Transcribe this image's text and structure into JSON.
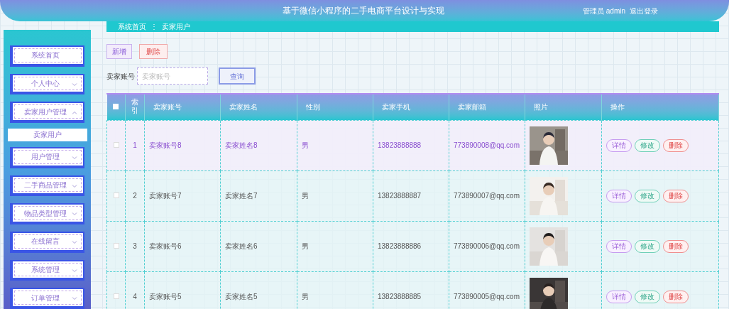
{
  "header": {
    "title": "基于微信小程序的二手电商平台设计与实现",
    "user": "管理员 admin",
    "logout": "退出登录"
  },
  "sidebar": {
    "items": [
      {
        "label": "系统首页",
        "kind": "link"
      },
      {
        "label": "个人中心",
        "kind": "menu",
        "expanded": false
      },
      {
        "label": "卖家用户管理",
        "kind": "menu",
        "expanded": true,
        "children": [
          {
            "label": "卖家用户"
          }
        ]
      },
      {
        "label": "用户管理",
        "kind": "menu",
        "expanded": false
      },
      {
        "label": "二手商品管理",
        "kind": "menu",
        "expanded": false
      },
      {
        "label": "物品类型管理",
        "kind": "menu",
        "expanded": false
      },
      {
        "label": "在线留言",
        "kind": "menu",
        "expanded": false
      },
      {
        "label": "系统管理",
        "kind": "menu",
        "expanded": false
      },
      {
        "label": "订单管理",
        "kind": "menu",
        "expanded": false
      }
    ]
  },
  "breadcrumb": [
    "系统首页",
    "卖家用户"
  ],
  "breadcrumb_separator": "⋮",
  "toolbar": {
    "add": "新增",
    "delete": "删除"
  },
  "search": {
    "label": "卖家账号",
    "placeholder": "卖家账号",
    "button": "查询"
  },
  "table": {
    "header_checked": false,
    "columns": [
      "索引",
      "卖家账号",
      "卖家姓名",
      "性别",
      "卖家手机",
      "卖家邮箱",
      "照片",
      "操作"
    ],
    "rows": [
      {
        "selected": true,
        "checked": false,
        "cells": [
          "1",
          "卖家账号8",
          "卖家姓名8",
          "男",
          "13823888888",
          "773890008@qq.com"
        ],
        "photo": {
          "kind": "picture"
        },
        "actions": [
          "详情",
          "修改",
          "删除"
        ]
      },
      {
        "selected": false,
        "checked": false,
        "cells": [
          "2",
          "卖家账号7",
          "卖家姓名7",
          "男",
          "13823888887",
          "773890007@qq.com"
        ],
        "photo": {
          "kind": "picture"
        },
        "actions": [
          "详情",
          "修改",
          "删除"
        ]
      },
      {
        "selected": false,
        "checked": false,
        "cells": [
          "3",
          "卖家账号6",
          "卖家姓名6",
          "男",
          "13823888886",
          "773890006@qq.com"
        ],
        "photo": {
          "kind": "picture"
        },
        "actions": [
          "详情",
          "修改",
          "删除"
        ]
      },
      {
        "selected": false,
        "checked": false,
        "cells": [
          "4",
          "卖家账号5",
          "卖家姓名5",
          "男",
          "13823888885",
          "773890005@qq.com"
        ],
        "photo": {
          "kind": "picture"
        },
        "actions": [
          "详情",
          "修改",
          "删除"
        ]
      }
    ]
  }
}
